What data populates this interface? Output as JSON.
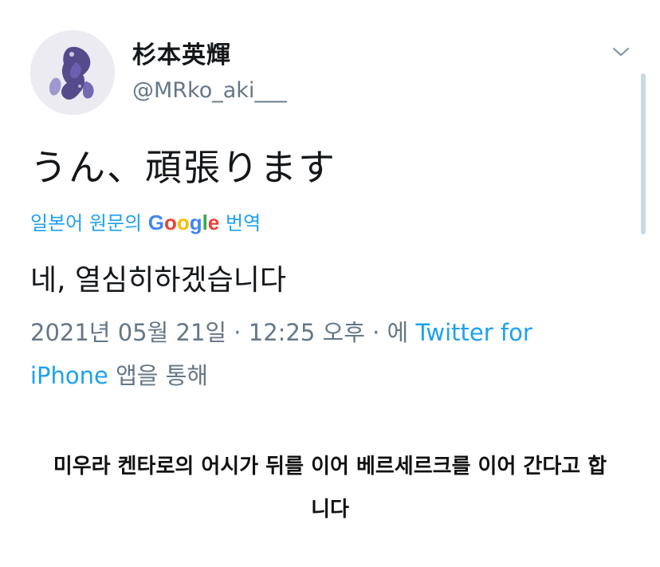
{
  "tweet": {
    "display_name": "杉本英輝",
    "handle": "@MRko_aki___",
    "text": "うん、頑張ります",
    "translate": {
      "prefix": "일본어 원문의",
      "google_letters": [
        "G",
        "o",
        "o",
        "g",
        "l",
        "e"
      ],
      "suffix": "번역"
    },
    "translated_text": "네, 열심히하겠습니다",
    "timestamp": "2021년 05월 21일 · 12:25 오후 · 에",
    "source_prefix": "Twitter for",
    "source_device": "iPhone",
    "source_suffix": "앱을 통해"
  },
  "caption": {
    "line1": "미우라 켄타로의 어시가 뒤를 이어 베르세르크를 이어 간다고 합",
    "line2": "니다"
  },
  "colors": {
    "link_blue": "#1da1f2",
    "muted_gray": "#657786",
    "scrollbar": "#c9d8e8"
  },
  "icons": {
    "avatar": "profile-avatar-image",
    "caret": "chevron-down-icon"
  }
}
